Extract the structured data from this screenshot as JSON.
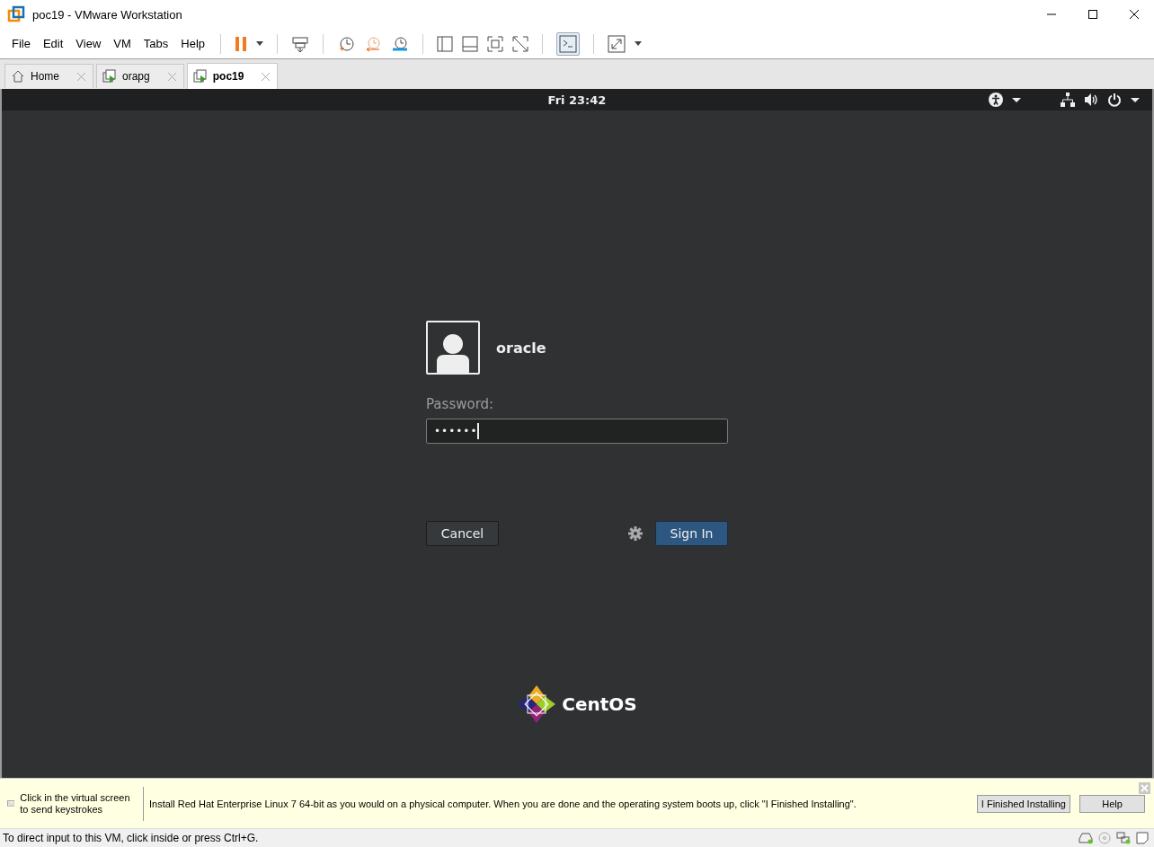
{
  "window": {
    "title": "poc19 - VMware Workstation"
  },
  "menu": [
    "File",
    "Edit",
    "View",
    "VM",
    "Tabs",
    "Help"
  ],
  "tabs": [
    {
      "label": "Home",
      "kind": "home",
      "selected": false
    },
    {
      "label": "orapg",
      "kind": "vm",
      "selected": false
    },
    {
      "label": "poc19",
      "kind": "vm",
      "selected": true
    }
  ],
  "guest": {
    "clock": "Fri 23:42",
    "user": "oracle",
    "password_label": "Password:",
    "password_value": "••••••",
    "cancel": "Cancel",
    "sign_in": "Sign In",
    "logo_text": "CentOS"
  },
  "hint_bar": {
    "keyboard_hint": "Click in the virtual screen to send keystrokes",
    "message": "Install Red Hat Enterprise Linux 7 64-bit as you would on a physical computer. When you are done and the operating system boots up, click \"I Finished Installing\".",
    "buttons": [
      "I Finished Installing",
      "Help"
    ]
  },
  "status_bar": {
    "text": "To direct input to this VM, click inside or press Ctrl+G."
  }
}
